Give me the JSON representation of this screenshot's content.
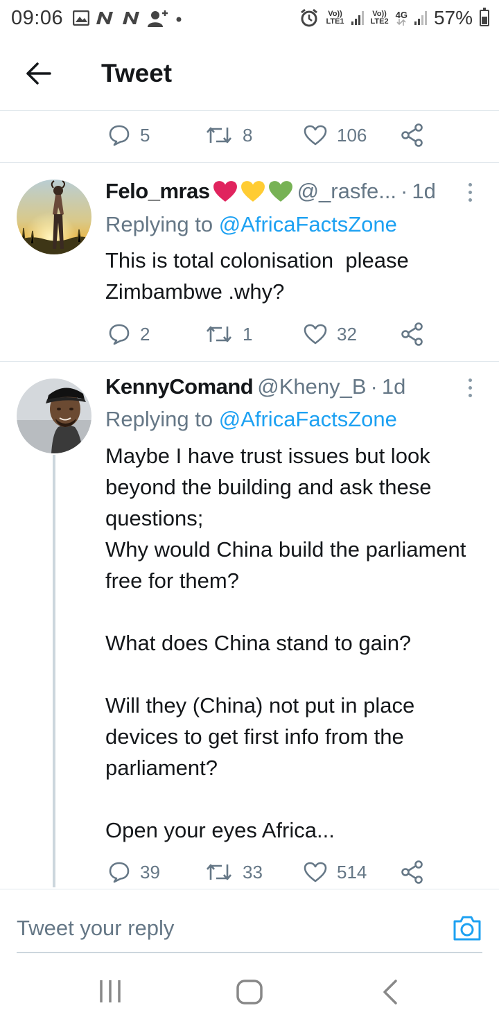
{
  "status_bar": {
    "time": "09:06",
    "net1_label_top": "Vo))",
    "net1_label_bottom": "LTE1",
    "net2_label_top": "Vo))",
    "net2_label_bottom": "LTE2",
    "net2_type": "4G",
    "battery": "57%"
  },
  "header": {
    "title": "Tweet"
  },
  "main_tweet_actions": {
    "replies": "5",
    "retweets": "8",
    "likes": "106"
  },
  "replies": [
    {
      "name": "Felo_mras",
      "handle": "@_rasfe...",
      "time": "1d",
      "replying_prefix": "Replying to",
      "replying_to": "@AfricaFactsZone",
      "text": "This is total colonisation  please Zimbambwe .why?",
      "replies": "2",
      "retweets": "1",
      "likes": "32"
    },
    {
      "name": "KennyComand",
      "handle": "@Kheny_B",
      "time": "1d",
      "replying_prefix": "Replying to",
      "replying_to": "@AfricaFactsZone",
      "text": "Maybe I have trust issues but look beyond the building and ask these questions;\nWhy would China build the parliament free for them?\n\nWhat does China stand to gain?\n\nWill they (China) not put in place devices to get first info from the parliament?\n\nOpen your eyes Africa...",
      "replies": "39",
      "retweets": "33",
      "likes": "514"
    }
  ],
  "reply_box": {
    "placeholder": "Tweet your reply"
  },
  "colors": {
    "accent": "#1da1f2",
    "muted": "#657786",
    "heart_red": "#e0245e",
    "heart_yellow": "#ffcc33",
    "heart_green": "#77b255"
  }
}
